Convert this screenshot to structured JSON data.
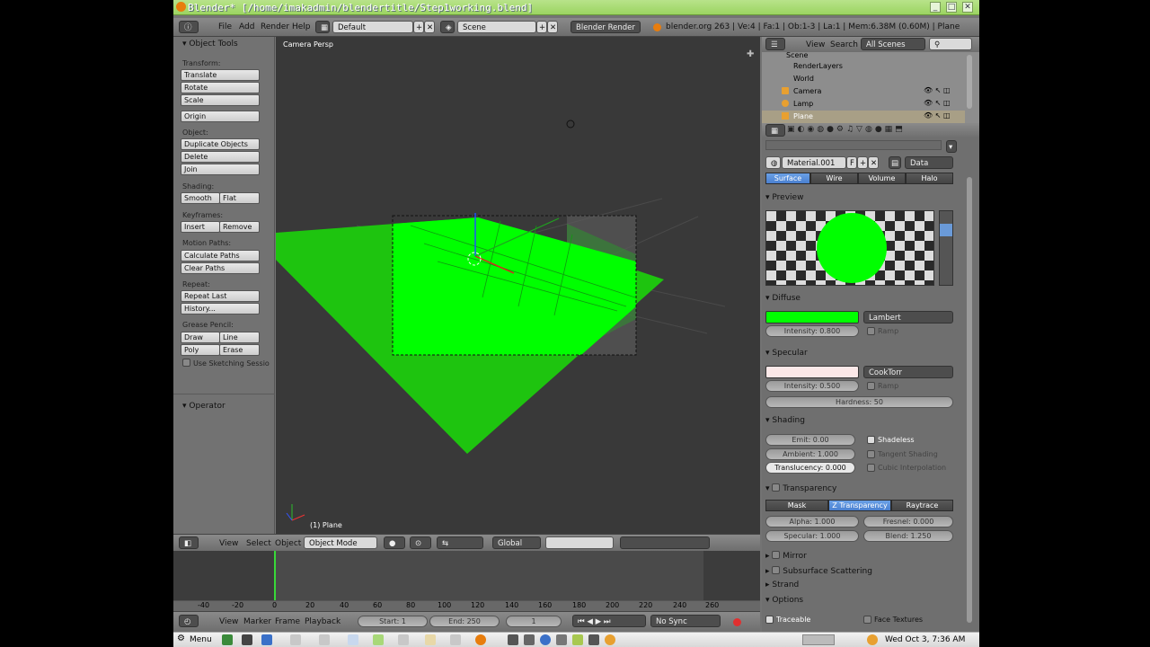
{
  "window": {
    "title": "Blender* [/home/imakadmin/blendertitle/Step1working.blend]"
  },
  "topbar": {
    "menus": [
      "File",
      "Add",
      "Render",
      "Help"
    ],
    "screen_layout": "Default",
    "scene": "Scene",
    "render_engine": "Blender Render",
    "info": "blender.org 263 | Ve:4 | Fa:1 | Ob:1-3 | La:1 | Mem:6.38M (0.60M) | Plane"
  },
  "toolshelf": {
    "title": "Object Tools",
    "transform_label": "Transform:",
    "translate": "Translate",
    "rotate": "Rotate",
    "scale": "Scale",
    "origin": "Origin",
    "object_label": "Object:",
    "duplicate": "Duplicate Objects",
    "delete": "Delete",
    "join": "Join",
    "shading_label": "Shading:",
    "smooth": "Smooth",
    "flat": "Flat",
    "keyframes_label": "Keyframes:",
    "insert": "Insert",
    "remove": "Remove",
    "motion_label": "Motion Paths:",
    "calc_paths": "Calculate Paths",
    "clear_paths": "Clear Paths",
    "repeat_label": "Repeat:",
    "repeat_last": "Repeat Last",
    "history": "History...",
    "grease_label": "Grease Pencil:",
    "draw": "Draw",
    "line": "Line",
    "poly": "Poly",
    "erase": "Erase",
    "use_sketching": "Use Sketching Sessio",
    "operator": "Operator"
  },
  "viewport": {
    "view_name": "Camera Persp",
    "object_name": "(1) Plane",
    "plane_color": "#00ff00"
  },
  "viewport_header": {
    "view": "View",
    "select": "Select",
    "object": "Object",
    "mode": "Object Mode",
    "orientation": "Global"
  },
  "timeline": {
    "ticks": [
      "-40",
      "-20",
      "0",
      "20",
      "40",
      "60",
      "80",
      "100",
      "120",
      "140",
      "160",
      "180",
      "200",
      "220",
      "240",
      "260"
    ],
    "view": "View",
    "marker": "Marker",
    "frame": "Frame",
    "playback": "Playback",
    "start": "Start: 1",
    "end": "End: 250",
    "current": "1",
    "sync": "No Sync"
  },
  "outliner": {
    "view": "View",
    "search": "Search",
    "filter": "All Scenes",
    "items": [
      "Scene",
      "RenderLayers",
      "World",
      "Camera",
      "Lamp",
      "Plane"
    ]
  },
  "properties": {
    "material_name": "Material.001",
    "material_flag": "F",
    "link": "Data",
    "tabs": [
      "Surface",
      "Wire",
      "Volume",
      "Halo"
    ],
    "preview_label": "Preview",
    "diffuse": {
      "label": "Diffuse",
      "color": "#00ff00",
      "shader": "Lambert",
      "intensity": "Intensity: 0.800",
      "ramp": "Ramp"
    },
    "specular": {
      "label": "Specular",
      "color": "#fbe8e8",
      "shader": "CookTorr",
      "intensity": "Intensity: 0.500",
      "ramp": "Ramp",
      "hardness": "Hardness: 50"
    },
    "shading": {
      "label": "Shading",
      "emit": "Emit: 0.00",
      "ambient": "Ambient: 1.000",
      "translucency": "Translucency: 0.000",
      "shadeless": "Shadeless",
      "tangent": "Tangent Shading",
      "cubic": "Cubic Interpolation"
    },
    "transparency": {
      "label": "Transparency",
      "modes": [
        "Mask",
        "Z Transparency",
        "Raytrace"
      ],
      "alpha": "Alpha: 1.000",
      "fresnel": "Fresnel: 0.000",
      "specular": "Specular: 1.000",
      "blend": "Blend: 1.250"
    },
    "mirror": "Mirror",
    "sss": "Subsurface Scattering",
    "strand": "Strand",
    "options": "Options",
    "traceable": "Traceable",
    "face_textures": "Face Textures"
  },
  "taskbar": {
    "menu": "Menu",
    "clock": "Wed Oct  3,  7:36 AM"
  }
}
